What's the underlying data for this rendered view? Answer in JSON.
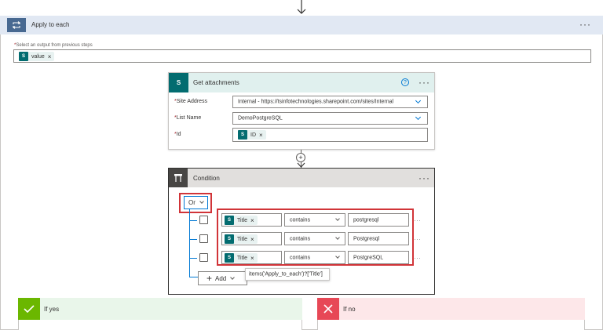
{
  "loop": {
    "title": "Apply to each",
    "select_label": "Select an output from previous steps",
    "token": "value"
  },
  "attachments": {
    "title": "Get attachments",
    "site_label": "Site Address",
    "site_value": "Internal - https://tsinfotechnologies.sharepoint.com/sites/Internal",
    "list_label": "List Name",
    "list_value": "DemoPostgreSQL",
    "id_label": "Id",
    "id_token": "ID"
  },
  "condition": {
    "title": "Condition",
    "group_operator": "Or",
    "rows": [
      {
        "token": "Title",
        "operator": "contains",
        "value": "postgresql"
      },
      {
        "token": "Title",
        "operator": "contains",
        "value": "Postgresql"
      },
      {
        "token": "Title",
        "operator": "contains",
        "value": "PostgreSQL"
      }
    ],
    "add_label": "Add",
    "tooltip": "items('Apply_to_each')?['Title']"
  },
  "branches": {
    "yes": "If yes",
    "no": "If no"
  },
  "colors": {
    "accent": "#0078d4",
    "sharepoint": "#036c70",
    "highlight": "#d13438",
    "condition_header": "#484644",
    "yes_bg": "#e9f6ea",
    "no_bg": "#fde7e9"
  }
}
